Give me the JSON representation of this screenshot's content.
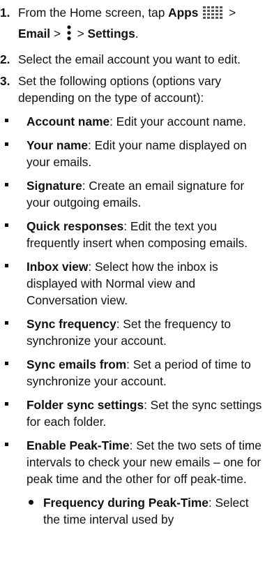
{
  "steps": {
    "s1": {
      "num": "1.",
      "text_a": "From the Home screen, tap ",
      "apps_label": "Apps",
      "apps_icon": "apps-grid-icon",
      "sep1": " >",
      "email_label": "Email",
      "sep2": " > ",
      "menu_icon": "more-options-icon",
      "sep3": " > ",
      "settings_label": "Settings",
      "end": "."
    },
    "s2": {
      "num": "2.",
      "text": "Select the email account you want to edit."
    },
    "s3": {
      "num": "3.",
      "text": "Set the following options (options vary depending on the type of account):"
    }
  },
  "options": [
    {
      "term": "Account name",
      "desc": ": Edit your account name."
    },
    {
      "term": "Your name",
      "desc": ": Edit your name displayed on your emails."
    },
    {
      "term": "Signature",
      "desc": ": Create an email signature for your outgoing emails."
    },
    {
      "term": "Quick responses",
      "desc": ": Edit the text you frequently insert when composing emails."
    },
    {
      "term": "Inbox view",
      "desc": ": Select how the inbox is displayed with Normal view and Conversation view."
    },
    {
      "term": "Sync frequency",
      "desc": ": Set the frequency to synchronize your account."
    },
    {
      "term": "Sync emails from",
      "desc": ": Set a period of time to synchronize your account."
    },
    {
      "term": "Folder sync settings",
      "desc": ": Set the sync settings for each folder."
    },
    {
      "term": "Enable Peak-Time",
      "desc": ": Set the two sets of time intervals to check your new emails – one for peak time and the other for off peak-time."
    }
  ],
  "sub_options": [
    {
      "term": "Frequency during Peak-Time",
      "desc": ": Select the time interval used by"
    }
  ]
}
